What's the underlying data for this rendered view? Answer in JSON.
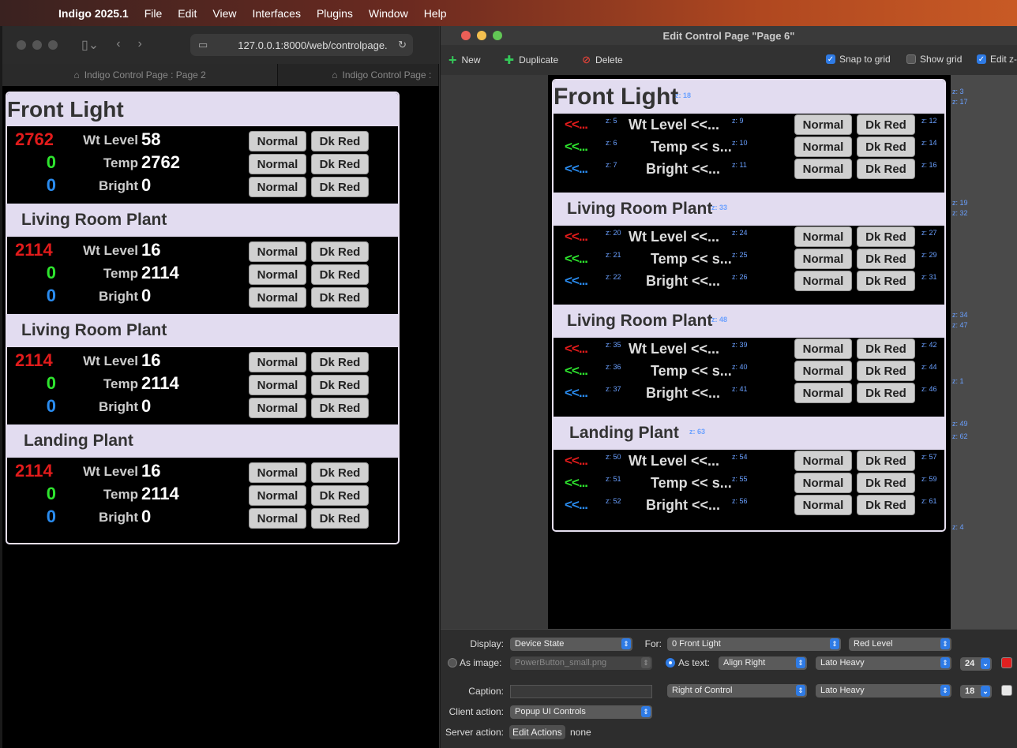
{
  "menubar": {
    "app": "Indigo 2025.1",
    "items": [
      "File",
      "Edit",
      "View",
      "Interfaces",
      "Plugins",
      "Window",
      "Help"
    ]
  },
  "browser": {
    "url": "127.0.0.1:8000/web/controlpage.",
    "tabs": [
      "Indigo Control Page : Page 2",
      "Indigo Control Page :"
    ]
  },
  "control_page": {
    "sections": [
      {
        "title": "Front Light",
        "red": "2762",
        "green": "0",
        "blue": "0",
        "wt_label": "Wt Level",
        "wt": "58",
        "temp_label": "Temp",
        "temp": "2762",
        "bright_label": "Bright",
        "bright": "0"
      },
      {
        "title": "Living Room Plant",
        "red": "2114",
        "green": "0",
        "blue": "0",
        "wt_label": "Wt Level",
        "wt": "16",
        "temp_label": "Temp",
        "temp": "2114",
        "bright_label": "Bright",
        "bright": "0"
      },
      {
        "title": "Living Room Plant",
        "red": "2114",
        "green": "0",
        "blue": "0",
        "wt_label": "Wt Level",
        "wt": "16",
        "temp_label": "Temp",
        "temp": "2114",
        "bright_label": "Bright",
        "bright": "0"
      },
      {
        "title": "Landing Plant",
        "red": "2114",
        "green": "0",
        "blue": "0",
        "wt_label": "Wt Level",
        "wt": "16",
        "temp_label": "Temp",
        "temp": "2114",
        "bright_label": "Bright",
        "bright": "0"
      }
    ],
    "btn_normal": "Normal",
    "btn_dkred": "Dk Red"
  },
  "editor": {
    "title": "Edit Control Page \"Page 6\"",
    "toolbar": {
      "new": "New",
      "duplicate": "Duplicate",
      "delete": "Delete",
      "snap": "Snap to grid",
      "show_grid": "Show grid",
      "edit_z": "Edit z-"
    },
    "arrow": "<<...",
    "wt_text": "Wt Level <<...",
    "temp_text": "Temp << s...",
    "bright_text": "Bright <<...",
    "sections": [
      {
        "title": "Front Light",
        "z_title": "z: 18",
        "z": [
          "z: 5",
          "z: 6",
          "z: 7",
          "z: 9",
          "z: 10",
          "z: 11",
          "z: 12",
          "z: 14",
          "z: 16"
        ]
      },
      {
        "title": "Living Room Plant",
        "z_title": "z: 33",
        "z": [
          "z: 20",
          "z: 21",
          "z: 22",
          "z: 24",
          "z: 25",
          "z: 26",
          "z: 27",
          "z: 29",
          "z: 31"
        ]
      },
      {
        "title": "Living Room Plant",
        "z_title": "z: 48",
        "z": [
          "z: 35",
          "z: 36",
          "z: 37",
          "z: 39",
          "z: 40",
          "z: 41",
          "z: 42",
          "z: 44",
          "z: 46"
        ]
      },
      {
        "title": "Landing Plant",
        "z_title": "z: 63",
        "z": [
          "z: 50",
          "z: 51",
          "z: 52",
          "z: 54",
          "z: 55",
          "z: 56",
          "z: 57",
          "z: 59",
          "z: 61"
        ]
      }
    ],
    "side_z": [
      "z: 3",
      "z: 17",
      "z: 19",
      "z: 32",
      "z: 34",
      "z: 47",
      "z: 1",
      "z: 49",
      "z: 62",
      "z: 4"
    ],
    "inspector": {
      "display_label": "Display:",
      "display_value": "Device State",
      "for_label": "For:",
      "for_value": "0 Front Light",
      "state_value": "Red Level",
      "as_image_label": "As image:",
      "image_value": "PowerButton_small.png",
      "as_text_label": "As text:",
      "align_value": "Align Right",
      "font_value": "Lato Heavy",
      "size_value": "24",
      "caption_label": "Caption:",
      "caption_pos": "Right of Control",
      "caption_font": "Lato Heavy",
      "caption_size": "18",
      "client_label": "Client action:",
      "client_value": "Popup UI Controls",
      "server_label": "Server action:",
      "server_btn": "Edit Actions",
      "server_value": "none",
      "text_color": "#e02020",
      "caption_color": "#e8e8e8"
    }
  }
}
